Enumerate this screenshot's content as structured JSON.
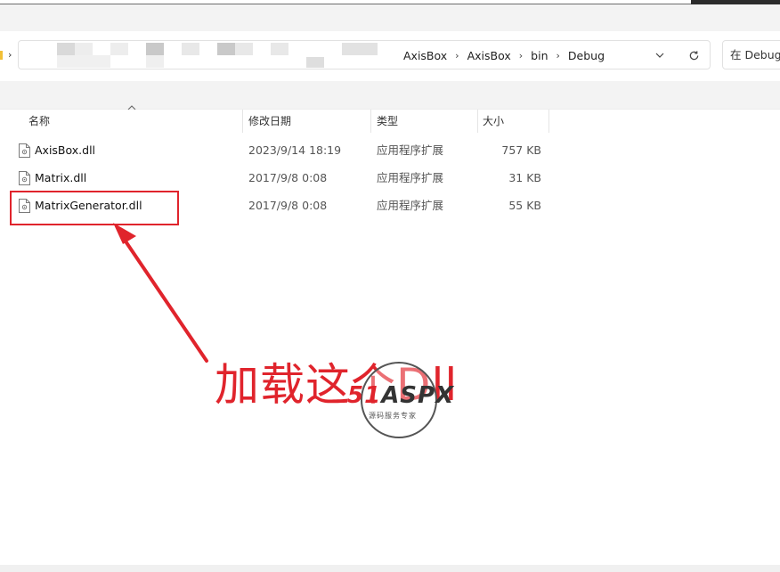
{
  "breadcrumb": [
    "AxisBox",
    "AxisBox",
    "bin",
    "Debug"
  ],
  "search": {
    "placeholder": "在 Debug 中搜索"
  },
  "columns": {
    "name": "名称",
    "date": "修改日期",
    "type": "类型",
    "size": "大小"
  },
  "files": [
    {
      "name": "AxisBox.dll",
      "date": "2023/9/14 18:19",
      "type": "应用程序扩展",
      "size": "757 KB"
    },
    {
      "name": "Matrix.dll",
      "date": "2017/9/8 0:08",
      "type": "应用程序扩展",
      "size": "31 KB"
    },
    {
      "name": "MatrixGenerator.dll",
      "date": "2017/9/8 0:08",
      "type": "应用程序扩展",
      "size": "55 KB"
    }
  ],
  "annotation": {
    "text": "加载这个Dll"
  },
  "watermark": {
    "logo_num": "51",
    "logo_text": "ASPX",
    "subtitle": "源码服务专家"
  },
  "colors": {
    "annotation_red": "#e0242c",
    "folder_yellow": "#f2c037",
    "toolbar_gray": "#f3f3f3"
  },
  "icons": [
    "chevron-right-icon",
    "chevron-down-icon",
    "refresh-icon",
    "sort-up-icon",
    "dll-file-icon"
  ]
}
